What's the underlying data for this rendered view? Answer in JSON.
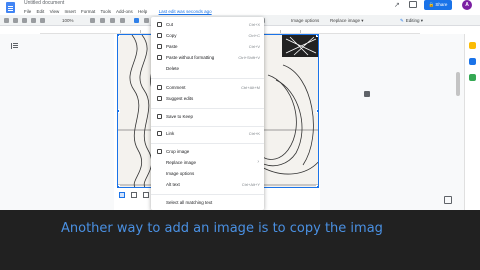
{
  "app": {
    "doc_title": "Untitled document",
    "menu": [
      "File",
      "Edit",
      "View",
      "Insert",
      "Format",
      "Tools",
      "Add-ons",
      "Help"
    ],
    "last_edit": "Last edit was seconds ago",
    "share_label": "Share",
    "avatar_letter": "A"
  },
  "toolbar": {
    "zoom": "100%",
    "image_options": "Image options",
    "replace_image": "Replace image ▾",
    "editing": "Editing"
  },
  "context_menu": {
    "items": [
      {
        "label": "Cut",
        "shortcut": "Ctrl+X",
        "icon": "scissors-icon"
      },
      {
        "label": "Copy",
        "shortcut": "Ctrl+C",
        "icon": "copy-icon"
      },
      {
        "label": "Paste",
        "shortcut": "Ctrl+V",
        "icon": "paste-icon"
      },
      {
        "label": "Paste without formatting",
        "shortcut": "Ctrl+Shift+V",
        "icon": "paste-plain-icon"
      },
      {
        "label": "Delete",
        "shortcut": "",
        "icon": ""
      },
      {
        "label": "Comment",
        "shortcut": "Ctrl+Alt+M",
        "icon": "comment-icon"
      },
      {
        "label": "Suggest edits",
        "shortcut": "",
        "icon": "suggest-icon"
      },
      {
        "label": "Save to Keep",
        "shortcut": "",
        "icon": "keep-icon"
      },
      {
        "label": "Link",
        "shortcut": "Ctrl+K",
        "icon": "link-icon"
      },
      {
        "label": "Crop image",
        "shortcut": "",
        "icon": "crop-icon"
      },
      {
        "label": "Replace image",
        "shortcut": "",
        "icon": ""
      },
      {
        "label": "Image options",
        "shortcut": "",
        "icon": ""
      },
      {
        "label": "Alt text",
        "shortcut": "Ctrl+Alt+Y",
        "icon": ""
      },
      {
        "label": "Select all matching text",
        "shortcut": "",
        "icon": ""
      }
    ]
  },
  "caption": "Another way to add an image is to copy the imag",
  "colors": {
    "accent": "#1a73e8",
    "caption_text": "#4a90e2",
    "caption_bg": "#212121"
  }
}
